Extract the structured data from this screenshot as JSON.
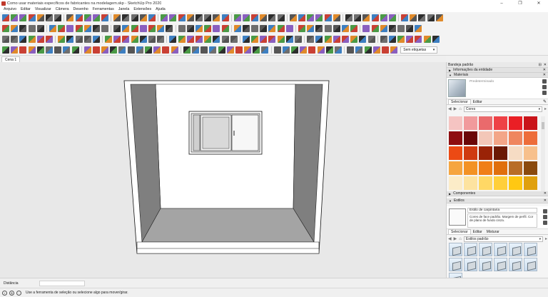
{
  "window": {
    "title": "Como usar materiais específicos de fabricantes na modelagem.skp - SketchUp Pro 2020",
    "minimize": "–",
    "maximize": "❐",
    "close": "✕"
  },
  "menu": [
    "Arquivo",
    "Editar",
    "Visualizar",
    "Câmera",
    "Desenho",
    "Ferramentas",
    "Janela",
    "Extensões",
    "Ajuda"
  ],
  "colors": {
    "accent": "#2b6cb0",
    "icon_blue": "#3d7fc1",
    "icon_red": "#c94034",
    "icon_gray": "#6e6e6e",
    "icon_green": "#4a9a46",
    "icon_orange": "#e08a2a",
    "wall_dark": "#7f7f7f",
    "floor": "#a4a4a4",
    "back_wall": "#ffffff"
  },
  "toolbars": {
    "tag_selector": "Sem etiquetas",
    "tag_chevron": "▾"
  },
  "scene": {
    "tab": "Cena 1"
  },
  "tray": {
    "title": "Bandeja padrão",
    "pin": "⊟",
    "close": "✕",
    "entity_info": "Informações da entidade",
    "materials": {
      "title": "Materiais",
      "current_material": "Predeterminado",
      "tabs": [
        "Selecionar",
        "Editar"
      ],
      "library": "Cores",
      "swatches": [
        "#f5c4c2",
        "#f19a9c",
        "#ea6a6c",
        "#ee4146",
        "#ea1f25",
        "#c9141a",
        "#8e0d10",
        "#6a0708",
        "#f3c7b8",
        "#f3a688",
        "#ef865f",
        "#ed6d3a",
        "#ec4a14",
        "#cf3a11",
        "#9a2307",
        "#6b1904",
        "#f6dcc4",
        "#f7c08c",
        "#f6a53f",
        "#f39224",
        "#f07e16",
        "#e06f0d",
        "#b86d27",
        "#8a4a0e",
        "#fcecc8",
        "#fde3a0",
        "#ffd865",
        "#ffcf3a",
        "#ffc812",
        "#e0a00d"
      ]
    },
    "components": {
      "title": "Componentes"
    },
    "styles": {
      "title": "Estilos",
      "style_name": "Estilo de carpintaria",
      "description": "Cores de face padrão. Margem de perfil. Cor de plano de fundo cinza.",
      "tabs": [
        "Selecionar",
        "Editar",
        "Misturar"
      ],
      "library": "Estilos padrão"
    }
  },
  "measurements": {
    "label": "Distância",
    "value": ""
  },
  "status": {
    "info_icon": "i",
    "geo_icon": "$",
    "message": "Use a ferramenta de seleção ou selecione algo para mover/girar."
  }
}
